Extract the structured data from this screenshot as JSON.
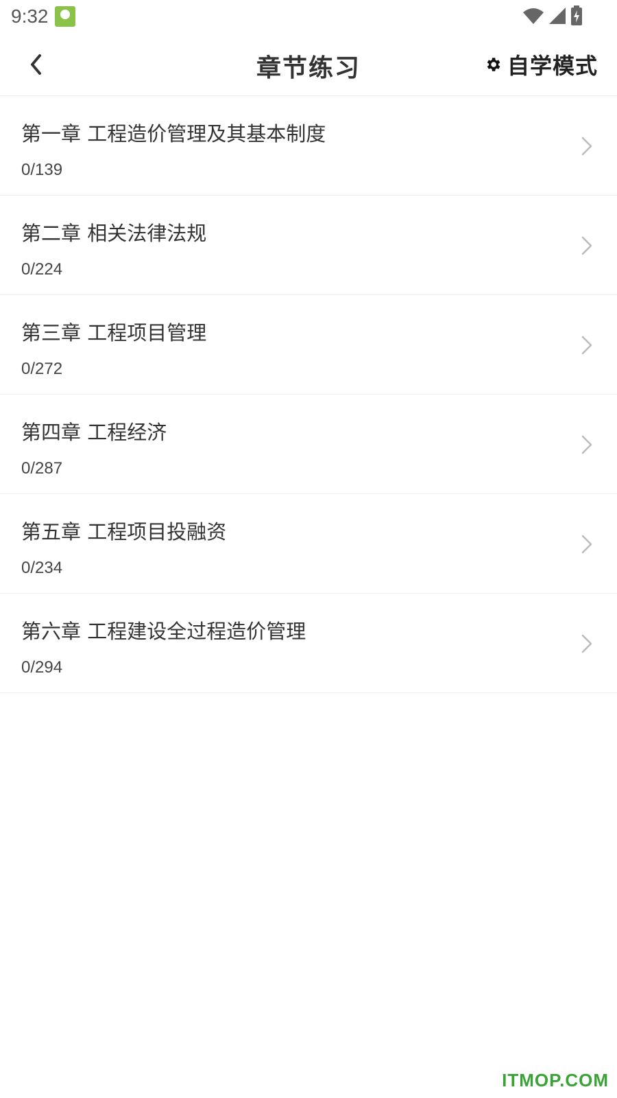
{
  "status_bar": {
    "time": "9:32",
    "icons": [
      "app-notification-icon",
      "wifi-icon",
      "cell-signal-icon",
      "battery-charging-icon"
    ]
  },
  "header": {
    "back_icon": "chevron-left-icon",
    "title": "章节练习",
    "mode_icon": "gear-icon",
    "mode_label": "自学模式"
  },
  "chapters": [
    {
      "title": "第一章 工程造价管理及其基本制度",
      "progress": "0/139"
    },
    {
      "title": "第二章 相关法律法规",
      "progress": "0/224"
    },
    {
      "title": "第三章 工程项目管理",
      "progress": "0/272"
    },
    {
      "title": "第四章 工程经济",
      "progress": "0/287"
    },
    {
      "title": "第五章 工程项目投融资",
      "progress": "0/234"
    },
    {
      "title": "第六章 工程建设全过程造价管理",
      "progress": "0/294"
    }
  ],
  "watermark": "ITMOP.COM",
  "colors": {
    "watermark": "#3aa335",
    "divider": "#eeeeee",
    "chevron": "#bbbbbb"
  }
}
